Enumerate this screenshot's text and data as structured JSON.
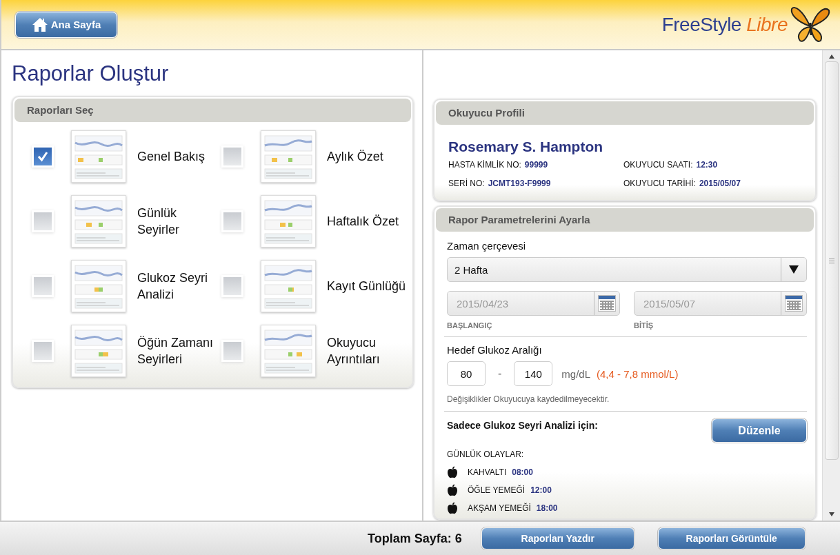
{
  "header": {
    "home_button": "Ana Sayfa",
    "logo": {
      "brand": "FreeStyle",
      "sub": "Libre"
    }
  },
  "page_title": "Raporlar Oluştur",
  "reports_panel": {
    "title": "Raporları Seç",
    "items": [
      {
        "label": "Genel Bakış",
        "checked": true
      },
      {
        "label": "Aylık Özet",
        "checked": false
      },
      {
        "label": "Günlük\nSeyirler",
        "checked": false
      },
      {
        "label": "Haftalık Özet",
        "checked": false
      },
      {
        "label": "Glukoz Seyri\nAnalizi",
        "checked": false
      },
      {
        "label": "Kayıt Günlüğü",
        "checked": false
      },
      {
        "label": "Öğün Zamanı\nSeyirleri",
        "checked": false
      },
      {
        "label": "Okuyucu\nAyrıntıları",
        "checked": false
      }
    ]
  },
  "profile": {
    "title": "Okuyucu Profili",
    "name": "Rosemary S. Hampton",
    "fields": [
      {
        "label": "HASTA KİMLİK NO:",
        "value": "99999"
      },
      {
        "label": "OKUYUCU SAATI:",
        "value": "12:30"
      },
      {
        "label": "SERİ NO:",
        "value": "JCMT193-F9999"
      },
      {
        "label": "OKUYUCU TARİHİ:",
        "value": "2015/05/07"
      }
    ]
  },
  "parameters": {
    "title": "Rapor Parametrelerini Ayarla",
    "timeframe_label": "Zaman çerçevesi",
    "timeframe": "2 Hafta",
    "start_date": "2015/04/23",
    "start_label": "BAŞLANGIÇ",
    "end_date": "2015/05/07",
    "end_label": "BİTİŞ",
    "target_label": "Hedef Glukoz Aralığı",
    "target_low": "80",
    "separator": "-",
    "target_high": "140",
    "unit": "mg/dL",
    "mmol": "(4,4 - 7,8 mmol/L)",
    "note": "Değişiklikler Okuyucuya kaydedilmeyecektir.",
    "analysis_label": "Sadece Glukoz Seyri Analizi için:",
    "edit_button": "Düzenle",
    "events_label": "GÜNLÜK OLAYLAR:",
    "events": [
      {
        "label": "KAHVALTI",
        "time": "08:00"
      },
      {
        "label": "ÖĞLE YEMEĞİ",
        "time": "12:00"
      },
      {
        "label": "AKŞAM YEMEĞİ",
        "time": "18:00"
      }
    ]
  },
  "footer": {
    "total_pages": "Toplam Sayfa: 6",
    "print_button": "Raporları Yazdır",
    "view_button": "Raporları Görüntüle"
  }
}
